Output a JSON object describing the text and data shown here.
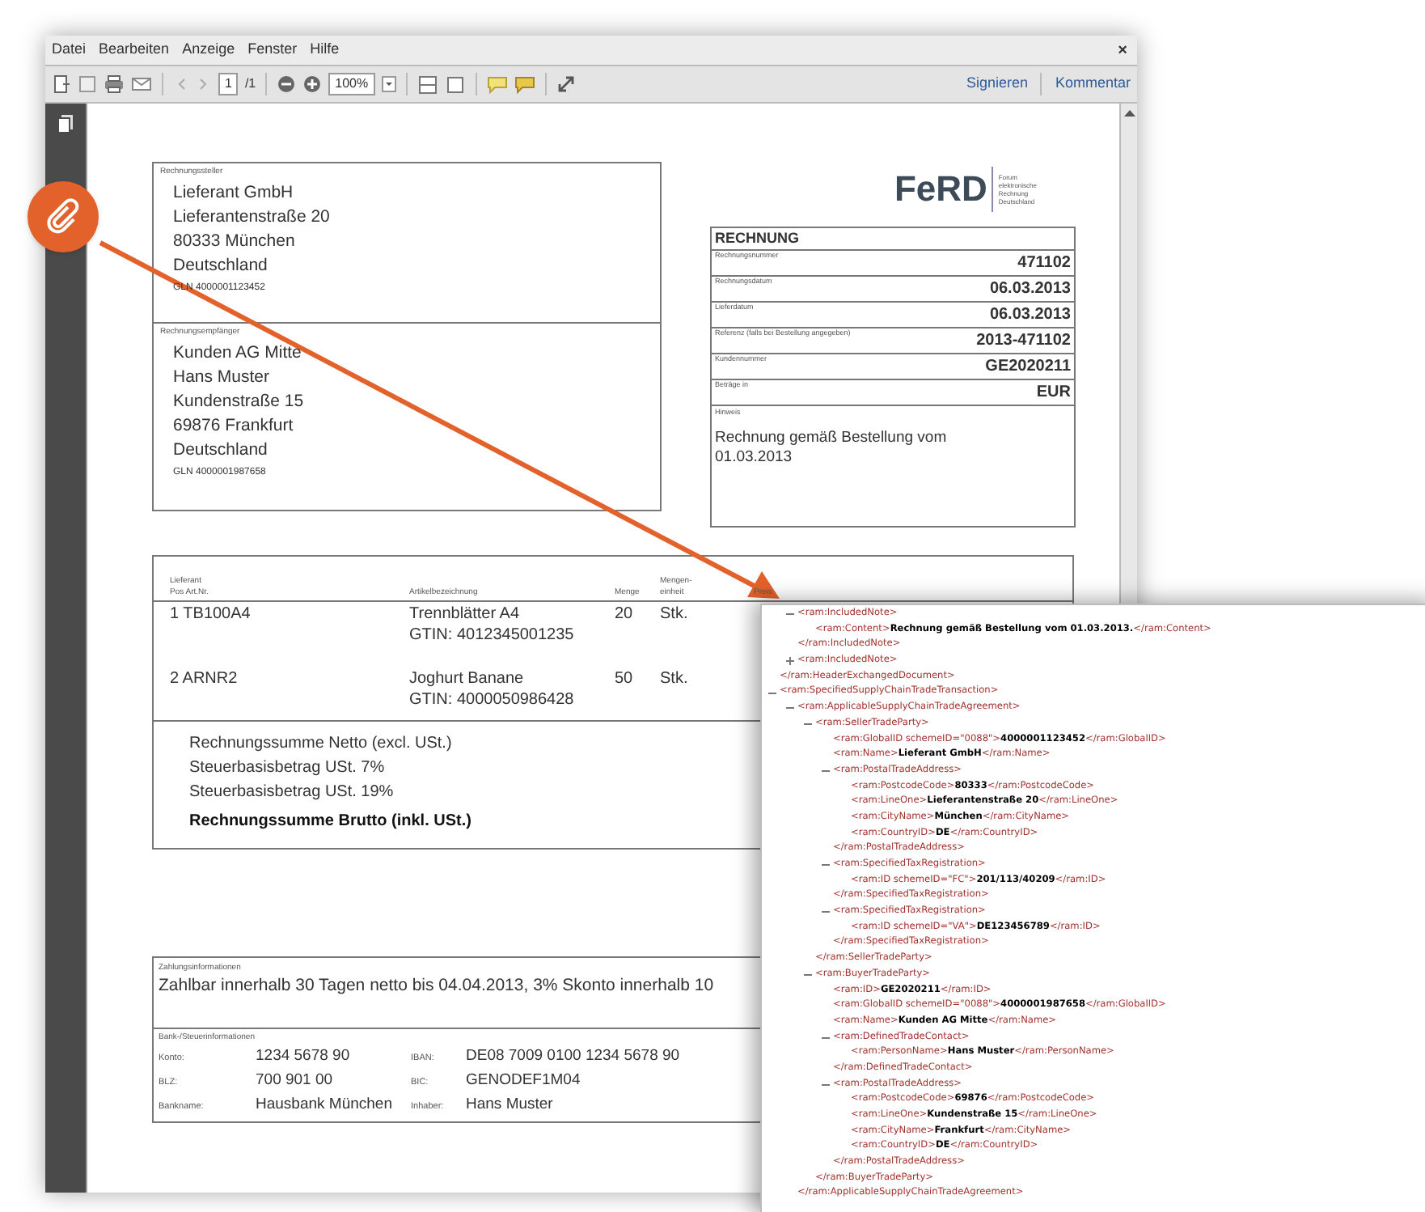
{
  "menu": [
    "Datei",
    "Bearbeiten",
    "Anzeige",
    "Fenster",
    "Hilfe"
  ],
  "window_close": "×",
  "toolbar": {
    "page": "1",
    "page_count": "/1",
    "zoom": "100%",
    "actions": [
      "Signieren",
      "Kommentar"
    ]
  },
  "document": {
    "logo": {
      "mark": "FeRD",
      "lines": [
        "Forum",
        "elektronische",
        "Rechnung",
        "Deutschland"
      ]
    },
    "seller": {
      "label": "Rechnungssteller",
      "lines": [
        "Lieferant GmbH",
        "Lieferantenstraße 20",
        "80333 München",
        "Deutschland"
      ],
      "gln": "GLN 4000001123452"
    },
    "buyer": {
      "label": "Rechnungsempfänger",
      "lines": [
        "Kunden AG Mitte",
        "Hans Muster",
        "Kundenstraße 15",
        "69876 Frankfurt",
        "Deutschland"
      ],
      "gln": "GLN 4000001987658"
    },
    "invoice": {
      "title": "RECHNUNG",
      "fields": [
        {
          "label": "Rechnungsnummer",
          "value": "471102"
        },
        {
          "label": "Rechnungsdatum",
          "value": "06.03.2013"
        },
        {
          "label": "Lieferdatum",
          "value": "06.03.2013"
        },
        {
          "label": "Referenz (falls bei Bestellung angegeben)",
          "value": "2013-471102"
        },
        {
          "label": "Kundennummer",
          "value": "GE2020211"
        },
        {
          "label": "Beträge in",
          "value": "EUR"
        }
      ],
      "note": {
        "label": "Hinweis",
        "text": "Rechnung gemäß Bestellung vom 01.03.2013"
      }
    },
    "items": {
      "columns": [
        {
          "lines": [
            "Lieferant",
            "Pos Art.Nr."
          ]
        },
        {
          "lines": [
            "Artikelbezeichnung"
          ]
        },
        {
          "lines": [
            "Menge"
          ]
        },
        {
          "lines": [
            "Mengen-",
            "einheit"
          ]
        },
        {
          "lines": [
            "Preis"
          ]
        }
      ],
      "rows": [
        {
          "position": "1 TB100A4",
          "description": [
            "Trennblätter A4",
            "GTIN: 4012345001235"
          ],
          "quantity": "20",
          "unit": "Stk."
        },
        {
          "position": "2 ARNR2",
          "description": [
            "Joghurt Banane",
            "GTIN: 4000050986428"
          ],
          "quantity": "50",
          "unit": "Stk."
        }
      ]
    },
    "totals": [
      {
        "text": "Rechnungssumme Netto (excl. USt.)",
        "kind": "line"
      },
      {
        "text": "Steuerbasisbetrag USt. 7%",
        "kind": "line"
      },
      {
        "text": "Steuerbasisbetrag USt. 19%",
        "kind": "line"
      },
      {
        "text": "Rechnungssumme Brutto (inkl. USt.)",
        "kind": "grand"
      }
    ],
    "payment": {
      "label": "Zahlungsinformationen",
      "text": "Zahlbar innerhalb 30 Tagen netto bis 04.04.2013, 3% Skonto innerhalb 10"
    },
    "bank": {
      "label": "Bank-/Steuerinformationen",
      "rows": [
        [
          "Konto:",
          "1234 5678 90",
          "IBAN:",
          "DE08 7009 0100 1234 5678 90"
        ],
        [
          "BLZ:",
          "700 901 00",
          "BIC:",
          "GENODEF1M04"
        ],
        [
          "Bankname:",
          "Hausbank München",
          "Inhaber:",
          "Hans Muster"
        ]
      ]
    }
  },
  "xml": {
    "nodes": [
      {
        "end": "</ram:HeaderExchangedDocument>",
        "children": [
          {
            "line": "<ram:IncludedNote>",
            "expanded": true,
            "children": [
              {
                "line": "<ram:Content>**Rechnung gemäß Bestellung vom 01.03.2013.**</ram:Content>"
              }
            ],
            "end": "</ram:IncludedNote>"
          },
          {
            "line": "<ram:IncludedNote>",
            "expanded": false
          }
        ]
      },
      {
        "line": "<ram:SpecifiedSupplyChainTradeTransaction>",
        "expanded": true,
        "children": [
          {
            "line": "<ram:ApplicableSupplyChainTradeAgreement>",
            "expanded": true,
            "children": [
              {
                "line": "<ram:SellerTradeParty>",
                "expanded": true,
                "children": [
                  {
                    "line": "<ram:GlobalID schemeID=\"0088\">**4000001123452**</ram:GlobalID>"
                  },
                  {
                    "line": "<ram:Name>**Lieferant GmbH**</ram:Name>"
                  },
                  {
                    "line": "<ram:PostalTradeAddress>",
                    "expanded": true,
                    "children": [
                      {
                        "line": "<ram:PostcodeCode>**80333**</ram:PostcodeCode>"
                      },
                      {
                        "line": "<ram:LineOne>**Lieferantenstraße 20**</ram:LineOne>"
                      },
                      {
                        "line": "<ram:CityName>**München**</ram:CityName>"
                      },
                      {
                        "line": "<ram:CountryID>**DE**</ram:CountryID>"
                      }
                    ],
                    "end": "</ram:PostalTradeAddress>"
                  },
                  {
                    "line": "<ram:SpecifiedTaxRegistration>",
                    "expanded": true,
                    "children": [
                      {
                        "line": "<ram:ID schemeID=\"FC\">**201/113/40209**</ram:ID>"
                      }
                    ],
                    "end": "</ram:SpecifiedTaxRegistration>"
                  },
                  {
                    "line": "<ram:SpecifiedTaxRegistration>",
                    "expanded": true,
                    "children": [
                      {
                        "line": "<ram:ID schemeID=\"VA\">**DE123456789**</ram:ID>"
                      }
                    ],
                    "end": "</ram:SpecifiedTaxRegistration>"
                  }
                ],
                "end": "</ram:SellerTradeParty>"
              },
              {
                "line": "<ram:BuyerTradeParty>",
                "expanded": true,
                "children": [
                  {
                    "line": "<ram:ID>**GE2020211**</ram:ID>"
                  },
                  {
                    "line": "<ram:GlobalID schemeID=\"0088\">**4000001987658**</ram:GlobalID>"
                  },
                  {
                    "line": "<ram:Name>**Kunden AG Mitte**</ram:Name>"
                  },
                  {
                    "line": "<ram:DefinedTradeContact>",
                    "expanded": true,
                    "children": [
                      {
                        "line": "<ram:PersonName>**Hans Muster**</ram:PersonName>"
                      }
                    ],
                    "end": "</ram:DefinedTradeContact>"
                  },
                  {
                    "line": "<ram:PostalTradeAddress>",
                    "expanded": true,
                    "children": [
                      {
                        "line": "<ram:PostcodeCode>**69876**</ram:PostcodeCode>"
                      },
                      {
                        "line": "<ram:LineOne>**Kundenstraße 15**</ram:LineOne>"
                      },
                      {
                        "line": "<ram:CityName>**Frankfurt**</ram:CityName>"
                      },
                      {
                        "line": "<ram:CountryID>**DE**</ram:CountryID>"
                      }
                    ],
                    "end": "</ram:PostalTradeAddress>"
                  }
                ],
                "end": "</ram:BuyerTradeParty>"
              }
            ],
            "end": "</ram:ApplicableSupplyChainTradeAgreement>"
          }
        ]
      }
    ]
  }
}
